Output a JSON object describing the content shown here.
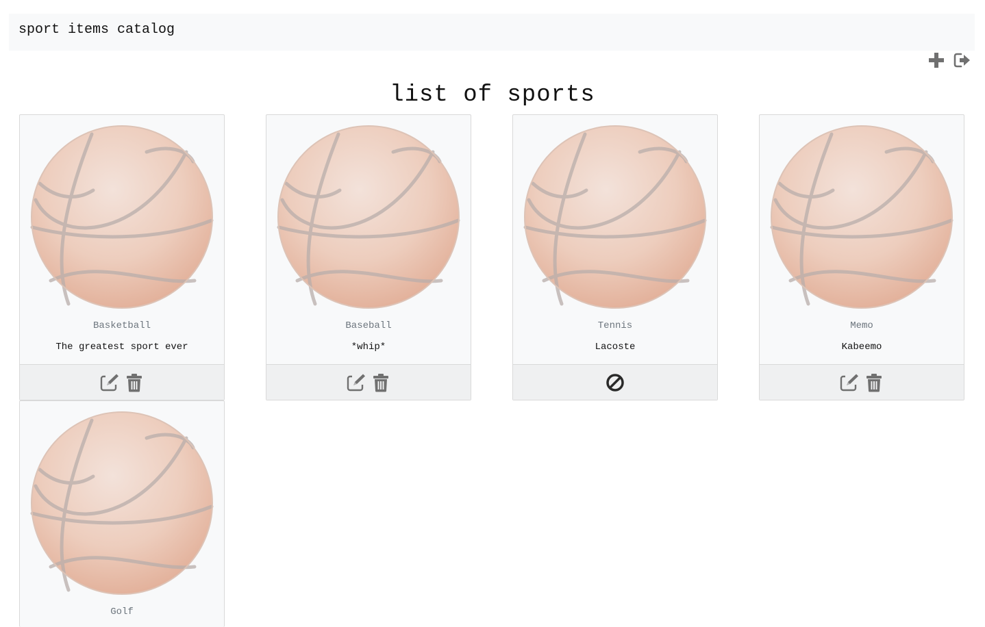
{
  "navbar": {
    "brand": "sport items catalog"
  },
  "toolbar": {
    "add_icon": "plus-icon",
    "logout_icon": "sign-out-icon"
  },
  "main": {
    "title": "list of sports"
  },
  "cards": [
    {
      "title": "Basketball",
      "description": "The greatest sport ever",
      "image": "basketball-image",
      "actions": [
        "edit-icon",
        "trash-icon"
      ]
    },
    {
      "title": "Baseball",
      "description": "*whip*",
      "image": "basketball-image",
      "actions": [
        "edit-icon",
        "trash-icon"
      ]
    },
    {
      "title": "Tennis",
      "description": "Lacoste",
      "image": "basketball-image",
      "actions": [
        "ban-icon"
      ]
    },
    {
      "title": "Memo",
      "description": "Kabeemo",
      "image": "basketball-image",
      "actions": [
        "edit-icon",
        "trash-icon"
      ]
    },
    {
      "title": "Golf",
      "description": "",
      "image": "basketball-image",
      "actions": []
    }
  ],
  "colors": {
    "navbar_bg": "#f8f9fa",
    "card_bg": "#f8f9fa",
    "footer_bg": "#eff0f1",
    "icon_gray": "#6f6f6f",
    "ball": "#e8a98e"
  }
}
